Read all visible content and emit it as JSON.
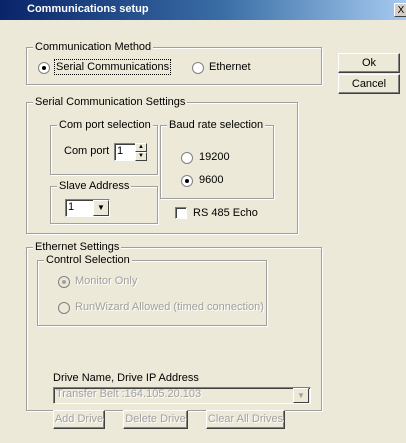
{
  "window": {
    "title": "Communications setup",
    "close_glyph": "X"
  },
  "buttons": {
    "ok": "Ok",
    "cancel": "Cancel"
  },
  "comm_method": {
    "legend": "Communication Method",
    "serial_label": "Serial Communications",
    "ethernet_label": "Ethernet",
    "selected": "serial"
  },
  "serial": {
    "legend": "Serial Communication Settings",
    "com_port": {
      "legend": "Com port selection",
      "label": "Com port",
      "value": "1"
    },
    "baud": {
      "legend": "Baud rate selection",
      "options": [
        "19200",
        "9600"
      ],
      "selected": "9600"
    },
    "slave": {
      "legend": "Slave Address",
      "value": "1"
    },
    "rs485_label": "RS 485 Echo",
    "rs485_checked": false
  },
  "ethernet": {
    "legend": "Ethernet Settings",
    "control": {
      "legend": "Control Selection",
      "monitor_only": "Monitor Only",
      "runwizard": "RunWizard Allowed (timed connection)",
      "selected": "monitor_only"
    },
    "drive_label": "Drive Name, Drive IP Address",
    "drive_value": "Transfer Belt :164.105.20.103",
    "add_drive": "Add Drive",
    "delete_drive": "Delete Drive",
    "clear_drives": "Clear All Drives"
  }
}
